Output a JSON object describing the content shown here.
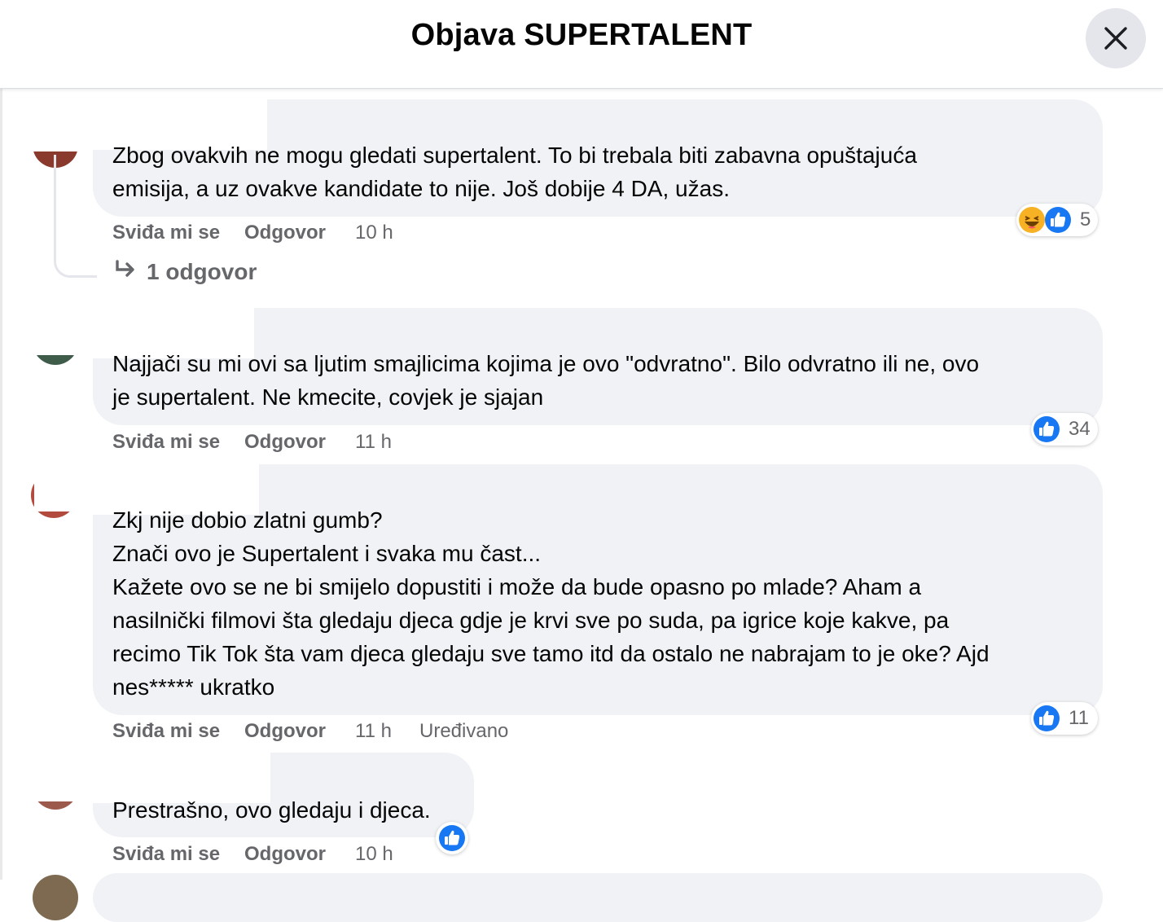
{
  "header": {
    "title": "Objava SUPERTALENT",
    "close_icon": "close-icon"
  },
  "actions_labels": {
    "like": "Sviđa mi se",
    "reply": "Odgovor"
  },
  "comments": [
    {
      "text": "Zbog ovakvih ne mogu gledati supertalent. To bi trebala biti zabavna opuštajuća\nemisija, a uz ovakve kandidate to nije. Još dobije 4 DA, užas.",
      "time": "10 h",
      "edited": "",
      "reaction_count": "5",
      "reaction_icons": [
        "haha-icon",
        "like-icon"
      ],
      "replies": "1 odgovor"
    },
    {
      "text": "Najjači su mi ovi sa ljutim smajlicima kojima je ovo \"odvratno\". Bilo odvratno ili ne, ovo\nje supertalent. Ne kmecite, covjek je sjajan",
      "time": "11 h",
      "edited": "",
      "reaction_count": "34",
      "reaction_icons": [
        "like-icon"
      ]
    },
    {
      "text": "Zkj nije dobio zlatni gumb?\nZnači ovo je Supertalent i svaka mu čast...\nKažete ovo se ne bi smijelo dopustiti i može da bude opasno po mlade? Aham a\nnasilnički filmovi šta gledaju djeca gdje je krvi sve po suda, pa igrice koje kakve, pa\nrecimo Tik Tok šta vam djeca gledaju sve tamo itd da ostalo ne nabrajam to je oke? Ajd\nnes***** ukratko",
      "time": "11 h",
      "edited": "Uređivano",
      "reaction_count": "11",
      "reaction_icons": [
        "like-icon"
      ]
    },
    {
      "text": "Prestrašno, ovo gledaju i djeca.",
      "time": "10 h",
      "edited": "",
      "reaction_count": "",
      "reaction_icons": [
        "like-icon"
      ]
    }
  ],
  "colors": {
    "bubble": "#f0f2f5",
    "secondary_text": "#65676b",
    "like_blue": "#1877f2",
    "haha_yellow": "#f7b125"
  }
}
